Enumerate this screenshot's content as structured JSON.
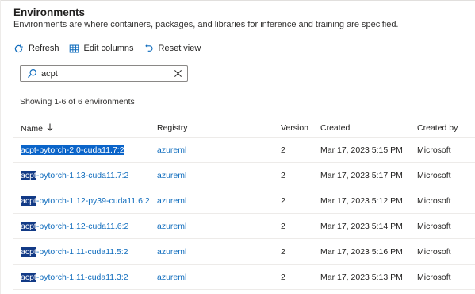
{
  "header": {
    "title": "Environments",
    "subtitle": "Environments are where containers, packages, and libraries for inference and training are specified."
  },
  "toolbar": {
    "refresh_label": "Refresh",
    "edit_columns_label": "Edit columns",
    "reset_view_label": "Reset view"
  },
  "search": {
    "value": "acpt",
    "query": "acpt"
  },
  "results_count": "Showing 1-6 of 6 environments",
  "table": {
    "columns": {
      "name": "Name",
      "registry": "Registry",
      "version": "Version",
      "created": "Created",
      "created_by": "Created by"
    },
    "rows": [
      {
        "name": "acpt-pytorch-2.0-cuda11.7:2",
        "registry": "azureml",
        "version": "2",
        "created": "Mar 17, 2023 5:15 PM",
        "created_by": "Microsoft",
        "selected": true
      },
      {
        "name": "acpt-pytorch-1.13-cuda11.7:2",
        "registry": "azureml",
        "version": "2",
        "created": "Mar 17, 2023 5:17 PM",
        "created_by": "Microsoft",
        "selected": false
      },
      {
        "name": "acpt-pytorch-1.12-py39-cuda11.6:2",
        "registry": "azureml",
        "version": "2",
        "created": "Mar 17, 2023 5:12 PM",
        "created_by": "Microsoft",
        "selected": false
      },
      {
        "name": "acpt-pytorch-1.12-cuda11.6:2",
        "registry": "azureml",
        "version": "2",
        "created": "Mar 17, 2023 5:14 PM",
        "created_by": "Microsoft",
        "selected": false
      },
      {
        "name": "acpt-pytorch-1.11-cuda11.5:2",
        "registry": "azureml",
        "version": "2",
        "created": "Mar 17, 2023 5:16 PM",
        "created_by": "Microsoft",
        "selected": false
      },
      {
        "name": "acpt-pytorch-1.11-cuda11.3:2",
        "registry": "azureml",
        "version": "2",
        "created": "Mar 17, 2023 5:13 PM",
        "created_by": "Microsoft",
        "selected": false
      }
    ]
  },
  "colors": {
    "link": "#0f6cbd",
    "highlight": "#0a64c9",
    "highlight_dark": "#123a86",
    "border": "#edebe9"
  }
}
